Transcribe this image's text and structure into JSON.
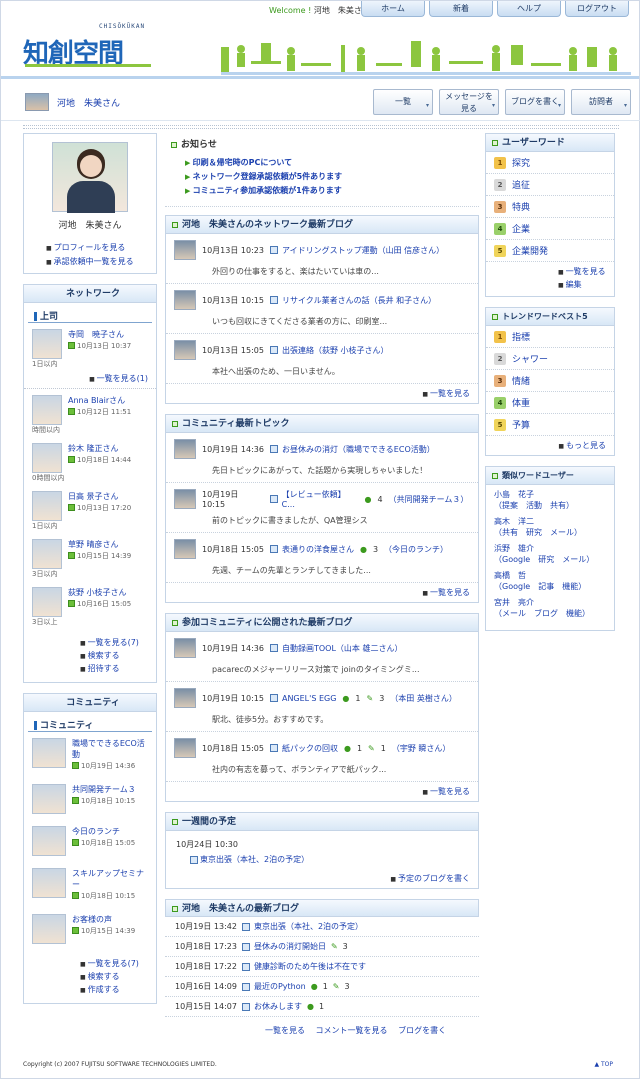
{
  "header": {
    "welcome": "Welcome !",
    "user": "河地　朱美さん",
    "nav": [
      "ホーム",
      "新着",
      "ヘルプ",
      "ログアウト"
    ],
    "logo_kana": "CHISŌKŪKAN",
    "logo_kanji": "知創空間"
  },
  "userbar": {
    "name": "河地　朱美さん",
    "buttons": [
      "一覧",
      "メッセージを\n見る",
      "ブログを書く",
      "訪問者"
    ]
  },
  "profile": {
    "name": "河地　朱美さん",
    "links": [
      "プロフィールを見る",
      "承認依頼中一覧を見る"
    ]
  },
  "network": {
    "title": "ネットワーク",
    "boss_label": "上司",
    "boss": [
      {
        "name": "寺岡　暁子さん",
        "date": "10月13日 10:37",
        "ago": "1日以内"
      }
    ],
    "boss_more": "一覧を見る(1)",
    "members": [
      {
        "name": "Anna Blairさん",
        "date": "10月12日 11:51",
        "ago": "時間以内"
      },
      {
        "name": "鈴木 隆正さん",
        "date": "10月18日 14:44",
        "ago": "0時間以内"
      },
      {
        "name": "日高 景子さん",
        "date": "10月13日 17:20",
        "ago": "1日以内"
      },
      {
        "name": "草野 晴彦さん",
        "date": "10月15日 14:39",
        "ago": "3日以内"
      },
      {
        "name": "荻野 小枝子さん",
        "date": "10月16日 15:05",
        "ago": "3日以上"
      }
    ],
    "links": [
      "一覧を見る(7)",
      "検索する",
      "招待する"
    ]
  },
  "community": {
    "title": "コミュニティ",
    "label": "コミュニティ",
    "items": [
      {
        "name": "職場でできるECO活動",
        "date": "10月19日 14:36"
      },
      {
        "name": "共同開発チーム３",
        "date": "10月18日 10:15"
      },
      {
        "name": "今日のランチ",
        "date": "10月18日 15:05"
      },
      {
        "name": "スキルアップセミナー",
        "date": "10月18日 10:15"
      },
      {
        "name": "お客様の声",
        "date": "10月15日 14:39"
      }
    ],
    "links": [
      "一覧を見る(7)",
      "検索する",
      "作成する"
    ]
  },
  "notice": {
    "title": "お知らせ",
    "items": [
      "印刷＆帰宅時のPCについて",
      "ネットワーク登録承認依頼が5件あります",
      "コミュニティ参加承認依頼が1件あります"
    ]
  },
  "netblog": {
    "title": "河地　朱美さんのネットワーク最新ブログ",
    "items": [
      {
        "date": "10月13日 10:23",
        "title": "アイドリングストップ運動（山田 信彦さん）",
        "body": "外回りの仕事をすると、楽はたいていは車の..."
      },
      {
        "date": "10月13日 10:15",
        "title": "リサイクル業者さんの話（長井 和子さん）",
        "body": "いつも回収にきてくださる業者の方に、印刷室..."
      },
      {
        "date": "10月13日 15:05",
        "title": "出張連絡（荻野 小枝子さん）",
        "body": "本社へ出張のため、一日いません。"
      }
    ],
    "more": "一覧を見る"
  },
  "topic": {
    "title": "コミュニティ最新トピック",
    "items": [
      {
        "date": "10月19日 14:36",
        "title": "お昼休みの消灯（職場でできるECO活動）",
        "body": "先日トピックにあがって、た話題から実現しちゃいました！"
      },
      {
        "date": "10月19日 10:15",
        "title": "【レビュー依頼】C...",
        "c": "4",
        "extra": "（共同開発チーム３）",
        "body": "前のトピックに書きましたが、QA管理シス"
      },
      {
        "date": "10月18日 15:05",
        "title": "表通りの洋食屋さん",
        "c": "3",
        "extra": "（今日のランチ）",
        "body": "先週、チームの先輩とランチしてきました..."
      }
    ],
    "more": "一覧を見る"
  },
  "commblog": {
    "title": "参加コミュニティに公開された最新ブログ",
    "items": [
      {
        "date": "10月19日 14:36",
        "title": "自動録画TOOL（山本 雄二さん）",
        "body": "pacarecのメジャーリリース対策で joinのタイミングミ..."
      },
      {
        "date": "10月19日 10:15",
        "title": "ANGEL'S EGG",
        "c": "1",
        "t": "3",
        "extra": "（本田 英樹さん）",
        "body": "駅北、徒歩5分。おすすめです。"
      },
      {
        "date": "10月18日 15:05",
        "title": "紙パックの回収",
        "c": "1",
        "t": "1",
        "extra": "（宇野 瞬さん）",
        "body": "社内の有志を募って、ボランティアで紙パック..."
      }
    ],
    "more": "一覧を見る"
  },
  "schedule": {
    "title": "一週間の予定",
    "date": "10月24日 10:30",
    "item": "東京出張（本社、2泊の予定）",
    "more": "予定のブログを書く"
  },
  "myblog": {
    "title": "河地　朱美さんの最新ブログ",
    "items": [
      {
        "date": "10月19日 13:42",
        "title": "東京出張（本社、2泊の予定）",
        "c": "",
        "t": ""
      },
      {
        "date": "10月18日 17:23",
        "title": "昼休みの消灯開始日",
        "c": "",
        "t": "3"
      },
      {
        "date": "10月18日 17:22",
        "title": "健康診断のため午後は不在です",
        "c": "",
        "t": ""
      },
      {
        "date": "10月16日 14:09",
        "title": "最近のPython",
        "c": "1",
        "t": "3"
      },
      {
        "date": "10月15日 14:07",
        "title": "お休みします",
        "c": "1",
        "t": ""
      }
    ],
    "links": [
      "一覧を見る",
      "コメント一覧を見る",
      "ブログを書く"
    ]
  },
  "userword": {
    "title": "ユーザーワード",
    "items": [
      "探究",
      "追征",
      "特典",
      "企業",
      "企業開発"
    ],
    "links": [
      "一覧を見る",
      "編集"
    ]
  },
  "trend": {
    "title": "トレンドワードベスト5",
    "items": [
      "指標",
      "シャワー",
      "情緒",
      "体重",
      "予算"
    ],
    "more": "もっと見る"
  },
  "similar": {
    "title": "類似ワードユーザー",
    "items": [
      {
        "name": "小島　花子",
        "tags": "（提案　活動　共有）"
      },
      {
        "name": "高木　洋二",
        "tags": "（共有　研究　メール）"
      },
      {
        "name": "浜野　雄介",
        "tags": "（Google　研究　メール）"
      },
      {
        "name": "高橋　哲",
        "tags": "（Google　記事　機能）"
      },
      {
        "name": "宮井　亮介",
        "tags": "（メール　ブログ　機能）"
      }
    ]
  },
  "footer": {
    "copy": "Copyright (c) 2007 FUJITSU SOFTWARE TECHNOLOGIES LIMITED.",
    "top": "TOP"
  }
}
